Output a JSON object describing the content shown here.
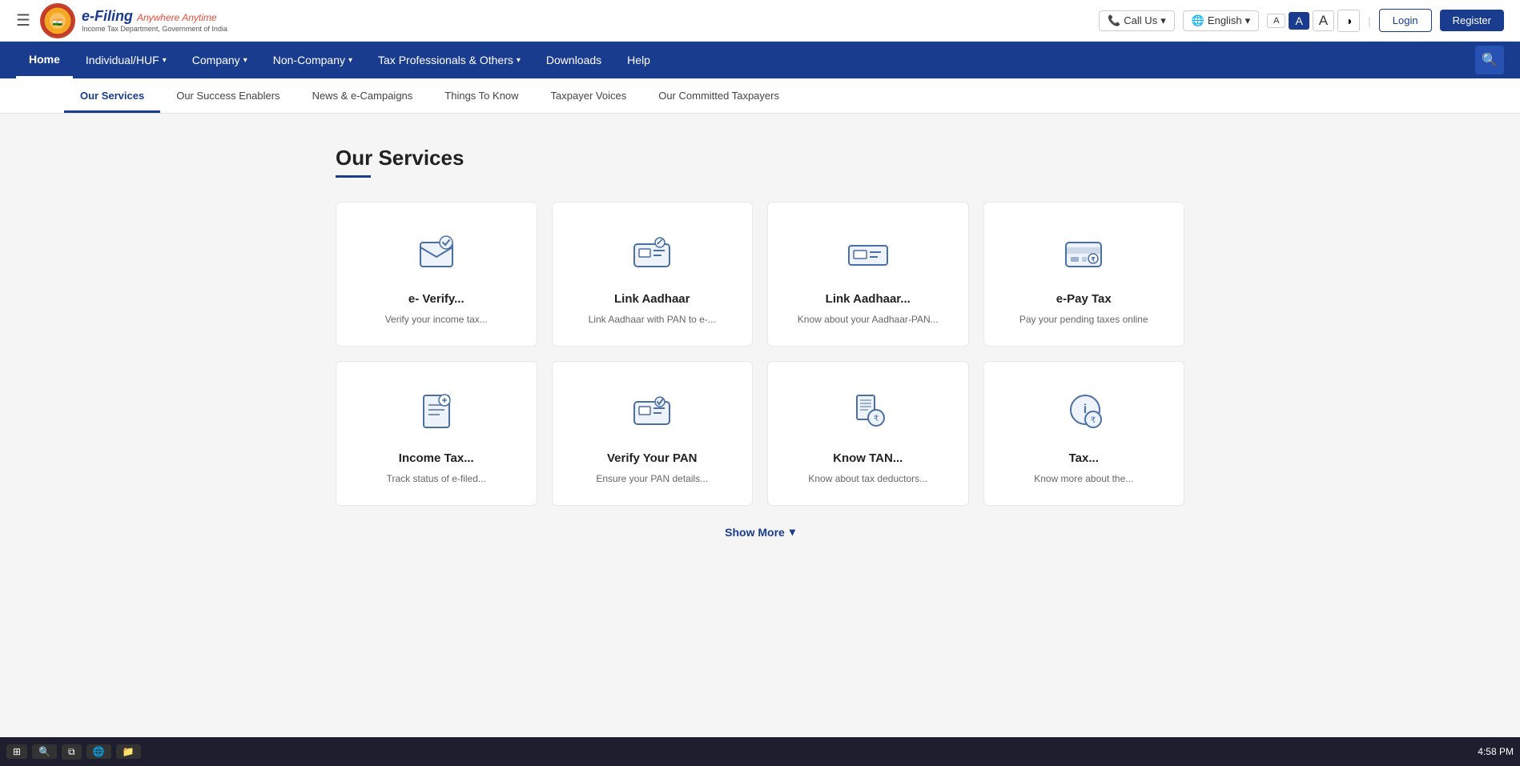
{
  "topBar": {
    "hamburger": "☰",
    "logoTitle": "e-Filing",
    "logoTitleHighlight": "Anywhere Anytime",
    "logoTagline": "Income Tax Department, Government of India",
    "callUs": "Call Us",
    "language": "English",
    "fontSmall": "A",
    "fontMedium": "A",
    "fontLarge": "A",
    "contrast": "◑",
    "login": "Login",
    "register": "Register"
  },
  "mainNav": {
    "items": [
      {
        "label": "Home",
        "active": true,
        "hasDropdown": false
      },
      {
        "label": "Individual/HUF",
        "active": false,
        "hasDropdown": true
      },
      {
        "label": "Company",
        "active": false,
        "hasDropdown": true
      },
      {
        "label": "Non-Company",
        "active": false,
        "hasDropdown": true
      },
      {
        "label": "Tax Professionals & Others",
        "active": false,
        "hasDropdown": true
      },
      {
        "label": "Downloads",
        "active": false,
        "hasDropdown": false
      },
      {
        "label": "Help",
        "active": false,
        "hasDropdown": false
      }
    ]
  },
  "subNav": {
    "items": [
      {
        "label": "Our Services",
        "active": true
      },
      {
        "label": "Our Success Enablers",
        "active": false
      },
      {
        "label": "News & e-Campaigns",
        "active": false
      },
      {
        "label": "Things To Know",
        "active": false
      },
      {
        "label": "Taxpayer Voices",
        "active": false
      },
      {
        "label": "Our Committed Taxpayers",
        "active": false
      }
    ]
  },
  "pageTitle": "Our Services",
  "services": {
    "row1": [
      {
        "name": "e- Verify...",
        "desc": "Verify your income tax...",
        "icon": "e-verify"
      },
      {
        "name": "Link Aadhaar",
        "desc": "Link Aadhaar with PAN to e-...",
        "icon": "link-aadhaar"
      },
      {
        "name": "Link Aadhaar...",
        "desc": "Know about your Aadhaar-PAN...",
        "icon": "link-aadhaar-status"
      },
      {
        "name": "e-Pay Tax",
        "desc": "Pay your pending taxes online",
        "icon": "e-pay"
      }
    ],
    "row2": [
      {
        "name": "Income Tax...",
        "desc": "Track status of e-filed...",
        "icon": "income-tax"
      },
      {
        "name": "Verify Your PAN",
        "desc": "Ensure your PAN details...",
        "icon": "verify-pan"
      },
      {
        "name": "Know TAN...",
        "desc": "Know about tax deductors...",
        "icon": "know-tan"
      },
      {
        "name": "Tax...",
        "desc": "Know more about the...",
        "icon": "tax-info"
      }
    ]
  },
  "showMore": "Show More",
  "taskbar": {
    "time": "4:58 PM"
  }
}
